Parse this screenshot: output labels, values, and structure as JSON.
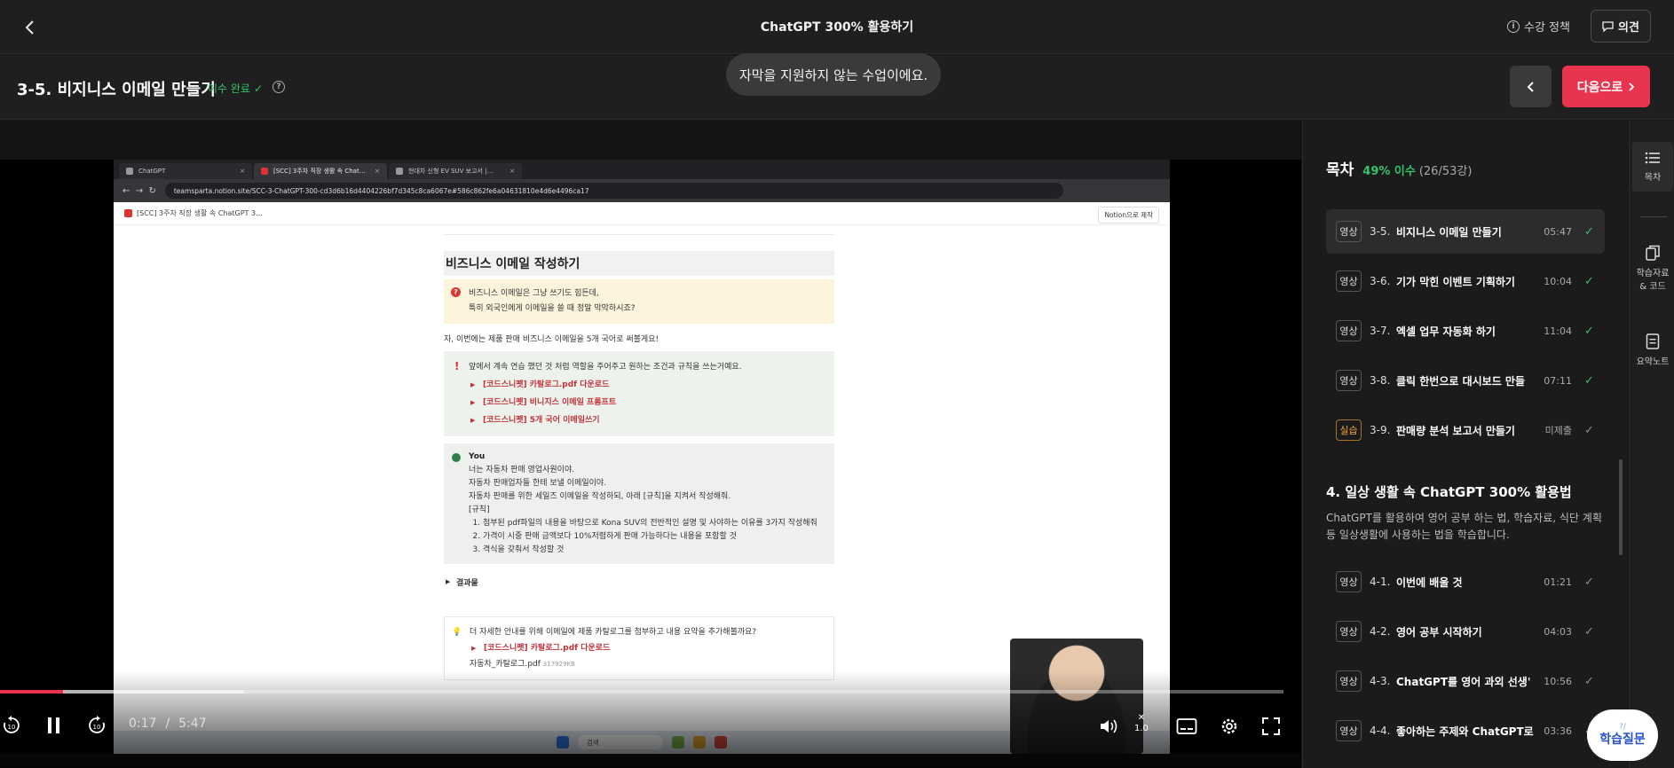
{
  "header": {
    "course_title": "ChatGPT 300% 활용하기",
    "policy_label": "수강 정책",
    "feedback_label": "의견"
  },
  "lesson": {
    "title": "3-5. 비지니스 이메일 만들기",
    "status": "이수 완료",
    "next_label": "다음으로"
  },
  "toast": "자막을 지원하지 않는 수업이에요.",
  "video": {
    "current_time": "0:17",
    "total_time": "5:47",
    "played_fraction": 0.049,
    "buffered_fraction": 0.19,
    "speed_value": "1.0",
    "browser_tabs": [
      "ChatGPT",
      "[SCC] 3주차 직장 생활 속 Chat…",
      "현대차 신형 EV SUV 보고서 |…"
    ],
    "url": "teamsparta.notion.site/SCC-3-ChatGPT-300-cd3d6b16d4404226bf7d345c8ca6067e#586c862fe6a04631810e4d6e4496ca17",
    "page_header": "[SCC] 3주차 직장 생활 속 ChatGPT 3…",
    "notion_button": "Notion으로 제작",
    "doc": {
      "heading": "비즈니스 이메일 작성하기",
      "callout_line1": "비즈니스 이메일은 그냥 쓰기도 힘든데,",
      "callout_line2": "특히 외국인에게 이메일을 쓸 때 정말 막막하시죠?",
      "intro": "자, 이번에는 제품 판매 비즈니스 이메일을 5개 국어로 써볼게요!",
      "tip": "앞에서 계속 연습 했던 것 처럼 역할을 주어주고 원하는 조건과 규칙을 쓰는거예요.",
      "toggles": [
        "[코드스니펫] 카탈로그.pdf 다운로드",
        "[코드스니펫] 비니지스 이메일 프롬프트",
        "[코드스니펫] 5개 국어 이메일쓰기"
      ],
      "you_label": "You",
      "you_lines": [
        "너는 자동차 판매 영업사원이야.",
        "자동차 판매업자들 한테 보낼 이메일이야.",
        "자동차 판매를 위한 세일즈 이메일을 작성하되, 아래 [규칙]을 지켜서 작성해줘.",
        "[규칙]"
      ],
      "rules": [
        "첨부된 pdf파일의 내용을 바탕으로 Kona SUV의 전반적인 설명 및 사야하는 이유를 3가지 작성해줘",
        "가격이 시중 판매 금액보다 10%저렴하게 판매 가능하다는 내용을 포함할 것",
        "격식을 갖춰서 작성할 것"
      ],
      "result_toggle": "결과물",
      "bottom_text": "더 자세한 안내를 위해 이메일에 제품 카탈로그를 첨부하고 내용 요약을 추가해볼까요?",
      "bottom_toggle": "[코드스니펫] 카탈로그.pdf 다운로드",
      "attachment": "자동차_카탈로그.pdf",
      "attachment_size": "317929KB"
    },
    "taskbar_search": "검색"
  },
  "toc": {
    "title": "목차",
    "percent": "49% 이수",
    "count": "(26/53강)",
    "items": [
      {
        "tag": "영상",
        "num": "3-5.",
        "name": "비지니스 이메일 만들기",
        "dur": "05:47",
        "done": true,
        "active": true
      },
      {
        "tag": "영상",
        "num": "3-6.",
        "name": "기가 막힌 이벤트 기획하기",
        "dur": "10:04",
        "done": true
      },
      {
        "tag": "영상",
        "num": "3-7.",
        "name": "엑셀 업무 자동화 하기",
        "dur": "11:04",
        "done": true
      },
      {
        "tag": "영상",
        "num": "3-8.",
        "name": "클릭 한번으로 대시보드 만들",
        "dur": "07:11",
        "done": true
      },
      {
        "tag": "실습",
        "num": "3-9.",
        "name": "판매량 분석 보고서 만들기",
        "dur": "미제출",
        "done": false
      }
    ],
    "section": {
      "title": "4. 일상 생활 속 ChatGPT 300% 활용법",
      "desc": "ChatGPT를 활용하여 영어 공부 하는 법, 학습자료, 식단 계획 등 일상생활에 사용하는 법을 학습합니다."
    },
    "items2": [
      {
        "tag": "영상",
        "num": "4-1.",
        "name": "이번에 배울 것",
        "dur": "01:21"
      },
      {
        "tag": "영상",
        "num": "4-2.",
        "name": "영어 공부 시작하기",
        "dur": "04:03"
      },
      {
        "tag": "영상",
        "num": "4-3.",
        "name": "ChatGPT를 영어 과외 선생'",
        "dur": "10:56"
      },
      {
        "tag": "영상",
        "num": "4-4.",
        "name": "좋아하는 주제와 ChatGPT로",
        "dur": "03:36"
      }
    ]
  },
  "rail": {
    "toc": "목차",
    "materials_line1": "학습자료",
    "materials_line2": "& 코드",
    "notes": "요약노트"
  },
  "qa": {
    "mark": "?/",
    "label": "학습질문"
  },
  "colors": {
    "accent": "#e8344e",
    "success": "#37c16a",
    "lab_tag": "#f0a43a"
  }
}
